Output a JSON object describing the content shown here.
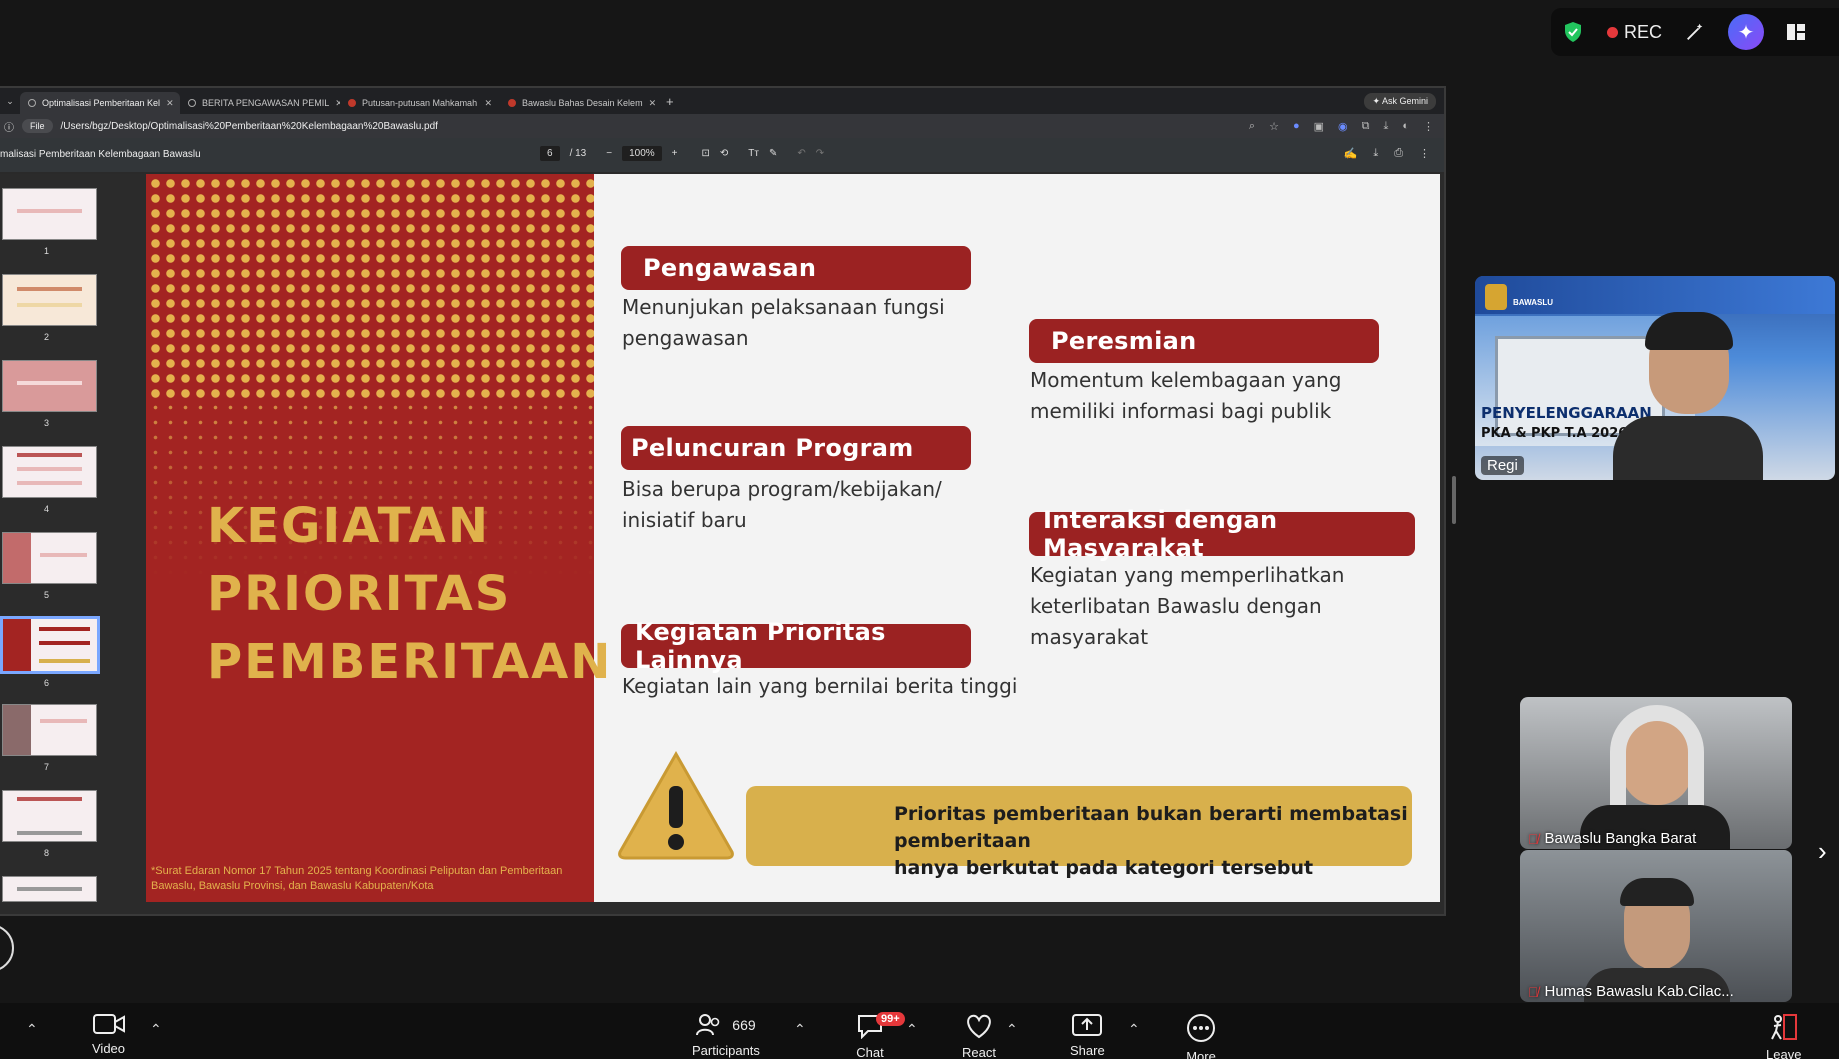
{
  "zoom_top": {
    "rec_label": "REC"
  },
  "browser": {
    "tabs": [
      {
        "label": "Optimalisasi Pemberitaan Kel"
      },
      {
        "label": "BERITA PENGAWASAN PEMIL"
      },
      {
        "label": "Putusan-putusan Mahkamah"
      },
      {
        "label": "Bawaslu Bahas Desain Kelem"
      }
    ],
    "gemini_label": "Ask Gemini",
    "url_chip": "File",
    "url": "/Users/bgz/Desktop/Optimalisasi%20Pemberitaan%20Kelembagaan%20Bawaslu.pdf"
  },
  "pdf": {
    "title": "malisasi Pemberitaan Kelembagaan Bawaslu",
    "page_current": "6",
    "page_total": "/ 13",
    "zoom": "100%",
    "thumbnails": [
      "1",
      "2",
      "3",
      "4",
      "5",
      "6",
      "7",
      "8"
    ]
  },
  "slide": {
    "big_title": [
      "KEGIATAN",
      "PRIORITAS",
      "PEMBERITAAN"
    ],
    "footnote": "*Surat Edaran Nomor 17 Tahun 2025 tentang Koordinasi Peliputan dan Pemberitaan Bawaslu, Bawaslu Provinsi, dan Bawaslu Kabupaten/Kota",
    "items": [
      {
        "title": "Pengawasan",
        "desc_lines": [
          "Menunjukan pelaksanaan fungsi",
          "pengawasan"
        ]
      },
      {
        "title": "Peresmian",
        "desc_lines": [
          "Momentum kelembagaan yang",
          "memiliki informasi bagi publik"
        ]
      },
      {
        "title": "Peluncuran Program",
        "desc_lines": [
          "Bisa berupa program/kebijakan/",
          "inisiatif baru"
        ]
      },
      {
        "title": "Interaksi dengan Masyarakat",
        "desc_lines": [
          "Kegiatan yang memperlihatkan",
          "keterlibatan Bawaslu dengan masyarakat"
        ]
      },
      {
        "title": "Kegiatan Prioritas Lainnya",
        "desc_lines": [
          "Kegiatan lain yang bernilai berita tinggi"
        ]
      }
    ],
    "warning_lines": [
      "Prioritas pemberitaan bukan berarti membatasi pemberitaan",
      "hanya berkutat pada kategori tersebut"
    ]
  },
  "participants": {
    "main": {
      "name": "Regi",
      "banner_line1": "PENYELENGGARAAN",
      "banner_line2": "PKA & PKP T.A 2026",
      "banner_logo": "BAWASLU"
    },
    "tiles": [
      {
        "name": "Bawaslu Bangka Barat"
      },
      {
        "name": "Humas Bawaslu Kab.Cilac..."
      }
    ]
  },
  "bottom_bar": {
    "video_label": "Video",
    "participants_count": "669",
    "participants_label": "Participants",
    "chat_label": "Chat",
    "chat_badge": "99+",
    "react_label": "React",
    "share_label": "Share",
    "more_label": "More",
    "leave_label": "Leave"
  }
}
